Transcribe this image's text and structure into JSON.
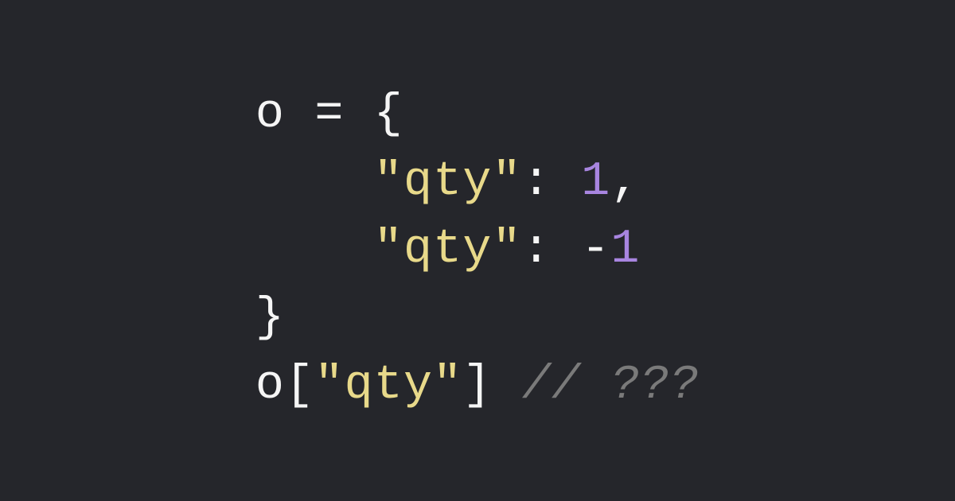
{
  "code": {
    "line1": {
      "var": "o",
      "assign": " = ",
      "braceOpen": "{"
    },
    "line2": {
      "indent": "    ",
      "key": "\"qty\"",
      "colon": ": ",
      "value": "1",
      "comma": ","
    },
    "line3": {
      "indent": "    ",
      "key": "\"qty\"",
      "colon": ": ",
      "minus": "-",
      "value": "1"
    },
    "line4": {
      "braceClose": "}"
    },
    "line5": {
      "var": "o",
      "bracketOpen": "[",
      "key": "\"qty\"",
      "bracketClose": "]",
      "space": " ",
      "comment": "// ???"
    }
  }
}
